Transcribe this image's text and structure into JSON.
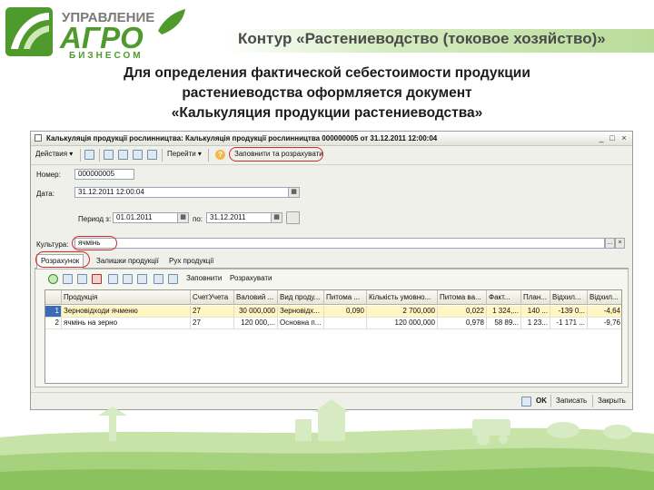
{
  "header": {
    "logo_line1": "УПРАВЛЕНИЕ",
    "logo_line2": "АГРО",
    "logo_line3": "БИЗНЕСОМ",
    "title": "Контур «Растениеводство (токовое хозяйство)»"
  },
  "caption": {
    "line1": "Для определения фактической себестоимости продукции",
    "line2": "растениеводства оформляется документ",
    "line3": "«Калькуляция продукции растениеводства»"
  },
  "window": {
    "title": "Калькуляція продукції рослинництва: Калькуляція продукції рослинництва 000000005 от 31.12.2011 12:00:04",
    "controls": [
      "_",
      "□",
      "×"
    ]
  },
  "toolbar": {
    "actions_label": "Действия ▾",
    "goto_label": "Перейти ▾",
    "help_label": "?",
    "fill_calc_label": "Заповнити та розрахувати"
  },
  "form": {
    "number_label": "Номер:",
    "number_value": "000000005",
    "date_label": "Дата:",
    "date_value": "31.12.2011 12:00:04",
    "period_from_label": "Период з:",
    "period_from_value": "01.01.2011",
    "period_to_label": "по:",
    "period_to_value": "31.12.2011",
    "culture_label": "Культура:",
    "culture_value": "ячмінь"
  },
  "tabs": [
    {
      "label": "Розрахунок",
      "active": true
    },
    {
      "label": "Залишки продукції",
      "active": false
    },
    {
      "label": "Рух продукції",
      "active": false
    }
  ],
  "panel_toolbar": {
    "fill_label": "Заповнити",
    "calc_label": "Розрахувати"
  },
  "table": {
    "columns": [
      "",
      "Продукція",
      "СчетУчета",
      "Валовий ...",
      "Вид проду...",
      "Питома ...",
      "Кількість умовно...",
      "Питома ва...",
      "Факт...",
      "План...",
      "Відхил...",
      "Відхил..."
    ],
    "rows": [
      [
        "1",
        "Зерновідходи ячменю",
        "27",
        "30 000,000",
        "Зерновідх...",
        "0,090",
        "2 700,000",
        "0,022",
        "1 324,...",
        "140 ...",
        "-139 0...",
        "-4,64"
      ],
      [
        "2",
        "ячмінь на зерно",
        "27",
        "120 000,...",
        "Основна п...",
        "",
        "120 000,000",
        "0,978",
        "58 89...",
        "1 23...",
        "-1 171 ...",
        "-9,76"
      ]
    ]
  },
  "footer": {
    "ok_label": "OK",
    "save_label": "Записать",
    "close_label": "Закрыть"
  },
  "colors": {
    "logo_green": "#4f9a2c",
    "annotation_red": "#d42a2a",
    "row_highlight": "#fff6c4"
  }
}
